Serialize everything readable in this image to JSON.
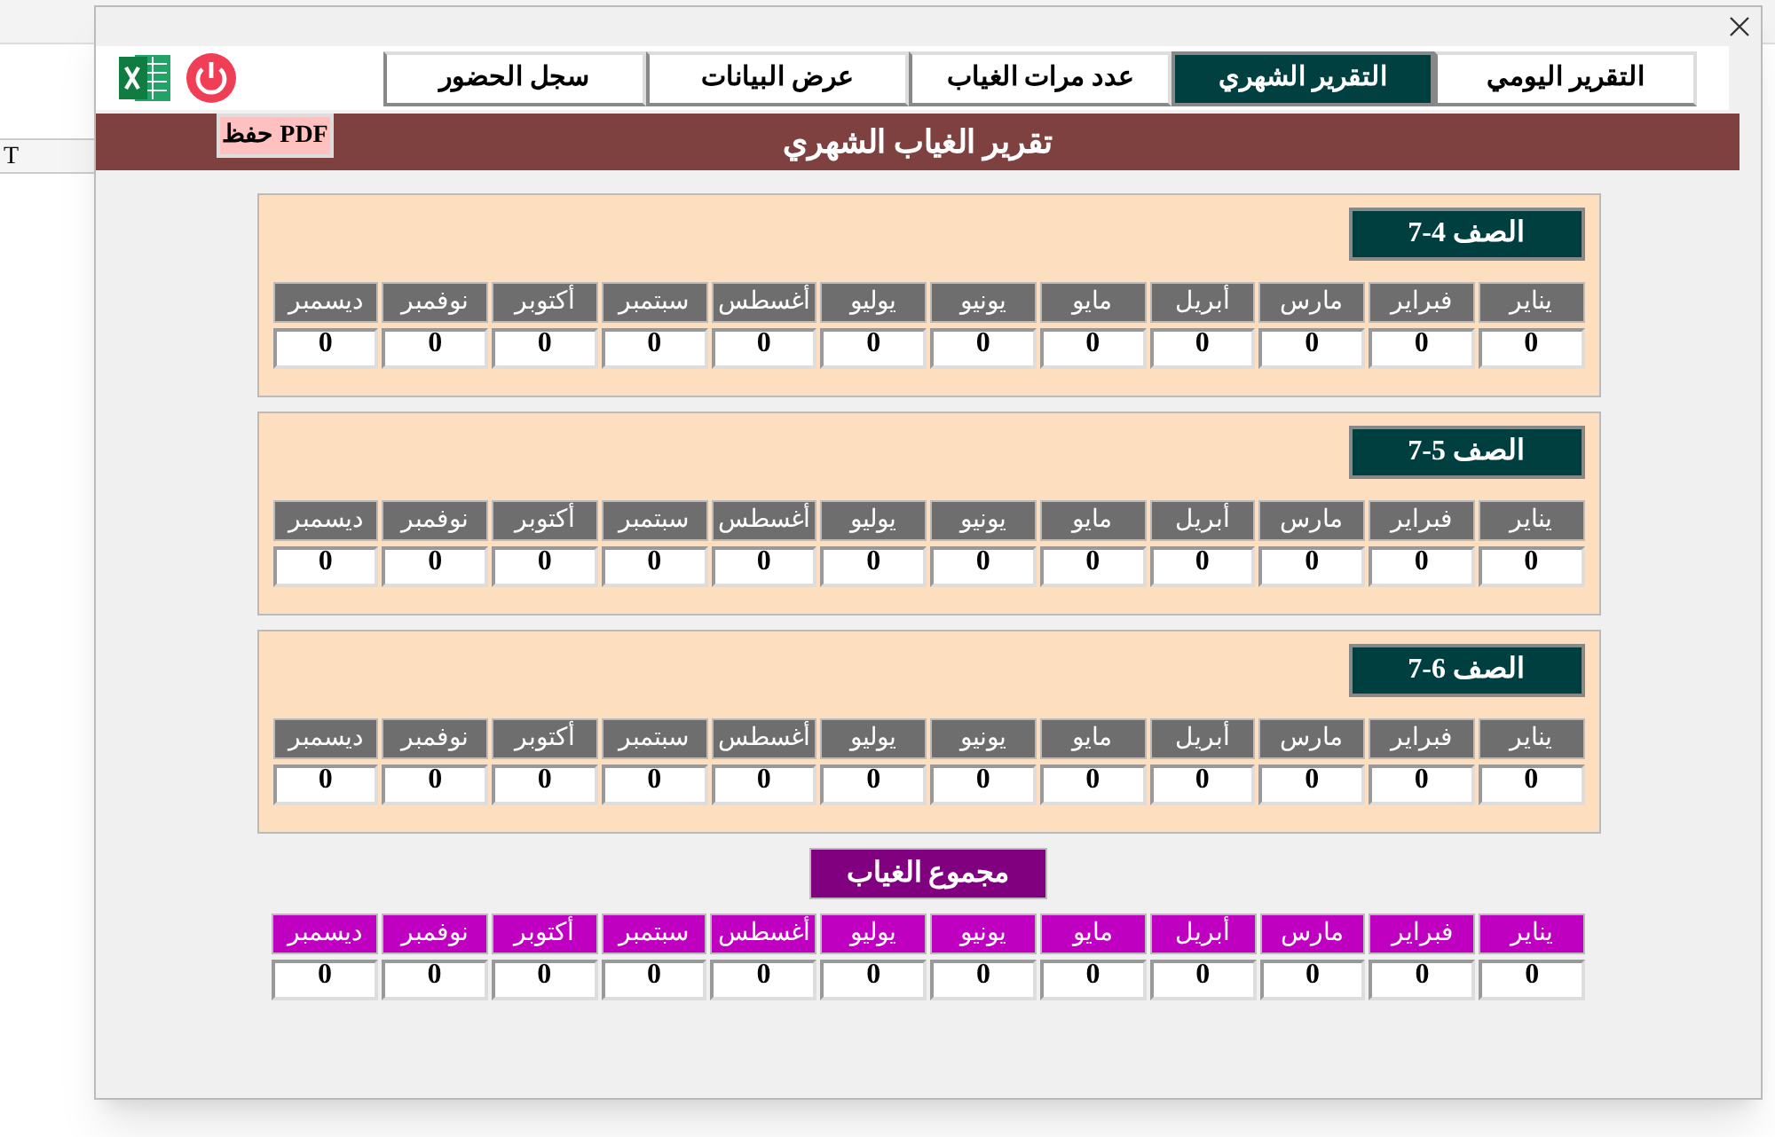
{
  "background": {
    "column_header": "T"
  },
  "tabs": [
    {
      "label": "التقرير اليومي",
      "selected": false
    },
    {
      "label": "التقرير الشهري",
      "selected": true
    },
    {
      "label": "عدد مرات الغياب",
      "selected": false
    },
    {
      "label": "عرض البيانات",
      "selected": false
    },
    {
      "label": "سجل الحضور",
      "selected": false
    }
  ],
  "header": {
    "title": "تقرير الغياب الشهري",
    "pdf_button": "حفظ PDF"
  },
  "sections": [
    {
      "label": "الصف 4-7",
      "months": [
        {
          "name": "يناير",
          "value": "0"
        },
        {
          "name": "فبراير",
          "value": "0"
        },
        {
          "name": "مارس",
          "value": "0"
        },
        {
          "name": "أبريل",
          "value": "0"
        },
        {
          "name": "مايو",
          "value": "0"
        },
        {
          "name": "يونيو",
          "value": "0"
        },
        {
          "name": "يوليو",
          "value": "0"
        },
        {
          "name": "أغسطس",
          "value": "0"
        },
        {
          "name": "سبتمبر",
          "value": "0"
        },
        {
          "name": "أكتوبر",
          "value": "0"
        },
        {
          "name": "نوفمبر",
          "value": "0"
        },
        {
          "name": "ديسمبر",
          "value": "0"
        }
      ]
    },
    {
      "label": "الصف 5-7",
      "months": [
        {
          "name": "يناير",
          "value": "0"
        },
        {
          "name": "فبراير",
          "value": "0"
        },
        {
          "name": "مارس",
          "value": "0"
        },
        {
          "name": "أبريل",
          "value": "0"
        },
        {
          "name": "مايو",
          "value": "0"
        },
        {
          "name": "يونيو",
          "value": "0"
        },
        {
          "name": "يوليو",
          "value": "0"
        },
        {
          "name": "أغسطس",
          "value": "0"
        },
        {
          "name": "سبتمبر",
          "value": "0"
        },
        {
          "name": "أكتوبر",
          "value": "0"
        },
        {
          "name": "نوفمبر",
          "value": "0"
        },
        {
          "name": "ديسمبر",
          "value": "0"
        }
      ]
    },
    {
      "label": "الصف 6-7",
      "months": [
        {
          "name": "يناير",
          "value": "0"
        },
        {
          "name": "فبراير",
          "value": "0"
        },
        {
          "name": "مارس",
          "value": "0"
        },
        {
          "name": "أبريل",
          "value": "0"
        },
        {
          "name": "مايو",
          "value": "0"
        },
        {
          "name": "يونيو",
          "value": "0"
        },
        {
          "name": "يوليو",
          "value": "0"
        },
        {
          "name": "أغسطس",
          "value": "0"
        },
        {
          "name": "سبتمبر",
          "value": "0"
        },
        {
          "name": "أكتوبر",
          "value": "0"
        },
        {
          "name": "نوفمبر",
          "value": "0"
        },
        {
          "name": "ديسمبر",
          "value": "0"
        }
      ]
    }
  ],
  "total": {
    "label": "مجموع الغياب",
    "months": [
      {
        "name": "يناير",
        "value": "0"
      },
      {
        "name": "فبراير",
        "value": "0"
      },
      {
        "name": "مارس",
        "value": "0"
      },
      {
        "name": "أبريل",
        "value": "0"
      },
      {
        "name": "مايو",
        "value": "0"
      },
      {
        "name": "يونيو",
        "value": "0"
      },
      {
        "name": "يوليو",
        "value": "0"
      },
      {
        "name": "أغسطس",
        "value": "0"
      },
      {
        "name": "سبتمبر",
        "value": "0"
      },
      {
        "name": "أكتوبر",
        "value": "0"
      },
      {
        "name": "نوفمبر",
        "value": "0"
      },
      {
        "name": "ديسمبر",
        "value": "0"
      }
    ]
  }
}
